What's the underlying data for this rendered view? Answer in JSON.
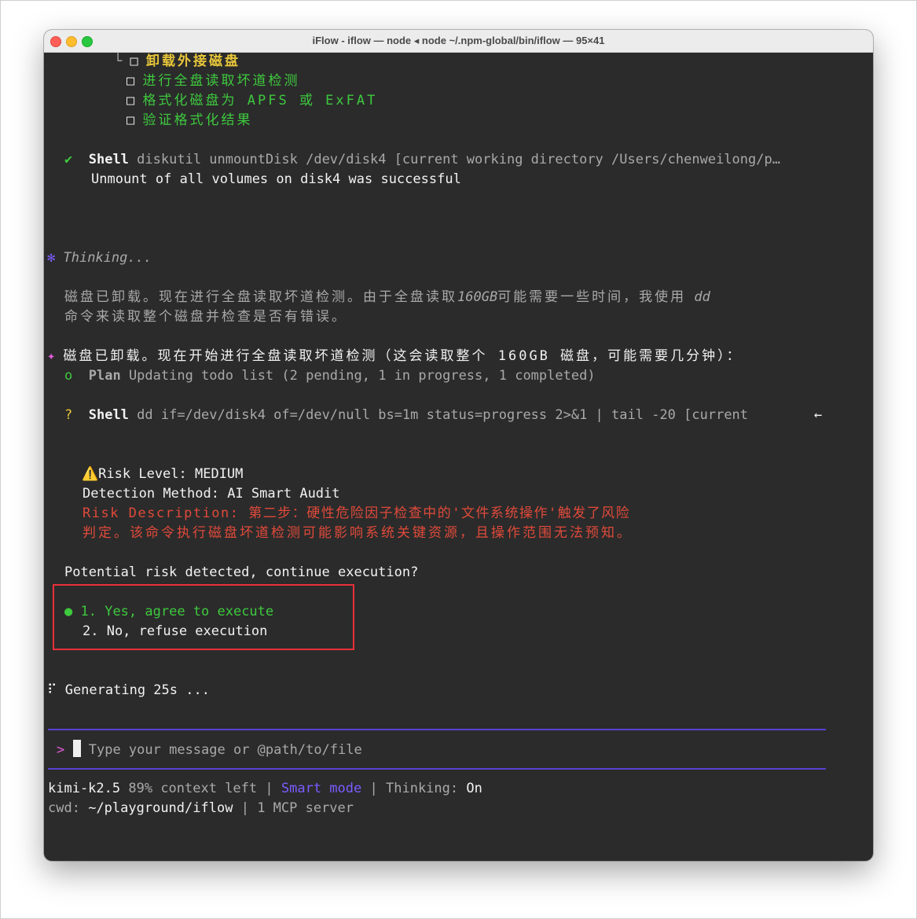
{
  "window": {
    "title": "iFlow - iflow — node ◂ node ~/.npm-global/bin/iflow — 95×41"
  },
  "todo": {
    "items": [
      {
        "prefix": "└",
        "box": "□",
        "label": "卸载外接磁盘",
        "active": true
      },
      {
        "box": "□",
        "label": "进行全盘读取坏道检测"
      },
      {
        "box": "□",
        "label": "格式化磁盘为 APFS 或 ExFAT"
      },
      {
        "box": "□",
        "label": "验证格式化结果"
      }
    ]
  },
  "shell1": {
    "mark": "✔",
    "tool": "Shell",
    "command": "diskutil unmountDisk /dev/disk4 [current working directory /Users/chenweilong/p…",
    "output": "Unmount of all volumes on disk4 was successful"
  },
  "thinking": {
    "icon": "✻",
    "label": "Thinking...",
    "text_line1_a": "磁盘已卸载。现在进行全盘读取坏道检测。由于全盘读取",
    "text_line1_b": "160GB",
    "text_line1_c": "可能需要一些时间，我使用",
    "text_line1_d": " dd",
    "text_line2": "命令来读取整个磁盘并检查是否有错误。"
  },
  "assistant": {
    "icon": "✦",
    "message": "磁盘已卸载。现在开始进行全盘读取坏道检测（这会读取整个 160GB 磁盘，可能需要几分钟）："
  },
  "plan": {
    "mark": "o",
    "tool": "Plan",
    "text": "Updating todo list (2 pending, 1 in progress, 1 completed)"
  },
  "shell2": {
    "mark": "?",
    "tool": "Shell",
    "command": "dd if=/dev/disk4 of=/dev/null bs=1m status=progress 2>&1 | tail -20 [current",
    "arrow": "←"
  },
  "risk": {
    "warning_icon": "⚠️",
    "level": "Risk Level: MEDIUM",
    "method": "Detection Method: AI Smart Audit",
    "description_line1": "Risk Description: 第二步：硬性危险因子检查中的'文件系统操作'触发了风险",
    "description_line2": "判定。该命令执行磁盘坏道检测可能影响系统关键资源，且操作范围无法预知。",
    "prompt": "Potential risk detected, continue execution?"
  },
  "options": [
    {
      "bullet": "●",
      "label": "1. Yes, agree to execute",
      "selected": true
    },
    {
      "bullet": "",
      "label": "2. No, refuse execution",
      "selected": false
    }
  ],
  "status": {
    "spinner": "⠏",
    "text": "Generating 25s ..."
  },
  "input": {
    "prompt": ">",
    "placeholder": "Type your message or @path/to/file"
  },
  "footer": {
    "model": "kimi-k2.5",
    "context": "89% context left",
    "separator": "|",
    "mode": "Smart mode",
    "thinking_label": "Thinking:",
    "thinking_value": "On",
    "cwd_label": "cwd:",
    "cwd_value": "~/playground/iflow",
    "mcp": "1 MCP server"
  },
  "colors": {
    "terminal_bg": "#2b2b2b",
    "green": "#3ec93e",
    "yellow": "#e8c63a",
    "red": "#e04a3a",
    "purple": "#7b5cff",
    "highlight_box": "#e8303b"
  }
}
